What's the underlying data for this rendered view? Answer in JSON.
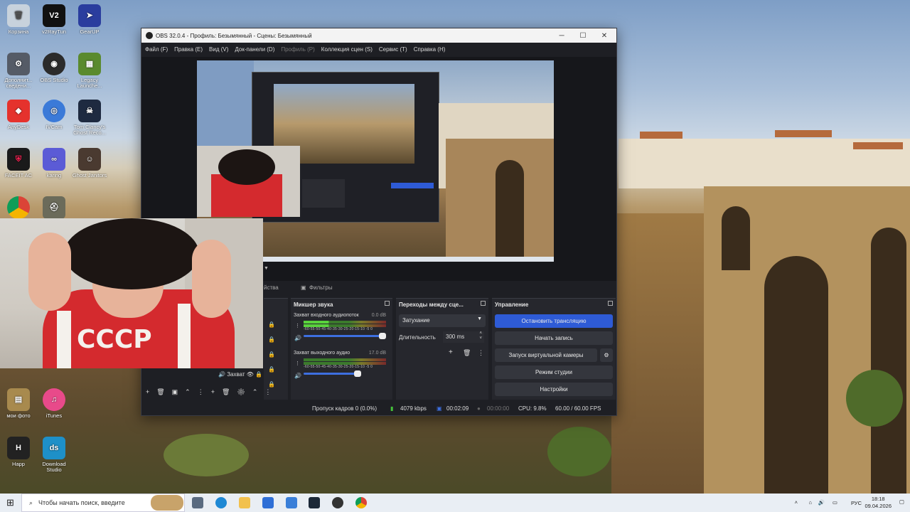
{
  "desktop": {
    "icons": [
      {
        "label": "Корзина",
        "color": "#c8d2dc"
      },
      {
        "label": "v2RayTun",
        "color": "#111111"
      },
      {
        "label": "GearUP",
        "color": "#2a3d9e"
      },
      {
        "label": "Дополнит... сведени...",
        "color": "#555b66"
      },
      {
        "label": "OBS Studio",
        "color": "#2b2b2b"
      },
      {
        "label": "Legacy Launche...",
        "color": "#5a8a2e"
      },
      {
        "label": "AnyDesk",
        "color": "#e5322d"
      },
      {
        "label": "IVCam",
        "color": "#3b7ad8"
      },
      {
        "label": "Tom Clancy's Ghost Reco...",
        "color": "#1e2a40"
      },
      {
        "label": "FACEIT AC",
        "color": "#1a1a1a"
      },
      {
        "label": "karing",
        "color": "#5b5bd6"
      },
      {
        "label": "Ghost Janitors",
        "color": "#4a3a30"
      },
      {
        "label": "мои фото",
        "color": "#a88a4e"
      },
      {
        "label": "iTunes",
        "color": "#e84a8a"
      },
      {
        "label": "Happ",
        "color": "#222222"
      },
      {
        "label": "Download Studio",
        "color": "#1e90c8"
      }
    ]
  },
  "obs": {
    "title": "OBS 32.0.4 - Профиль: Безымянный - Сцены: Безымянный",
    "menu": [
      "Файл (F)",
      "Правка (E)",
      "Вид (V)",
      "Док-панели (D)",
      "Профиль (P)",
      "Коллекция сцен (S)",
      "Сервис (T)",
      "Справка (H)"
    ],
    "tabs": {
      "props": "йства",
      "filters": "Фильтры"
    },
    "mixer": {
      "title": "Микшер звука",
      "channels": [
        {
          "name": "Захват входного аудиопоток",
          "db": "0.0 dB",
          "level": 0.3
        },
        {
          "name": "Захват выходного аудио",
          "db": "17.0 dB",
          "level": 0.0
        }
      ],
      "scale": "-60-55-50-45-40-35-30-25-20-15-10 -5 0"
    },
    "transitions": {
      "title": "Переходы между сце...",
      "selected": "Затухание",
      "duration_label": "Длительность",
      "duration_value": "300 ms"
    },
    "controls": {
      "title": "Управление",
      "stop_stream": "Остановить трансляцию",
      "start_record": "Начать запись",
      "virtual_cam": "Запуск виртуальной камеры",
      "studio_mode": "Режим студии",
      "settings": "Настройки"
    },
    "sources_partial": "Захват",
    "status": {
      "dropped": "Пропуск кадров 0 (0.0%)",
      "bitrate": "4079 kbps",
      "stream_time": "00:02:09",
      "record_time": "00:00:00",
      "cpu": "CPU: 9.8%",
      "fps": "60.00 / 60.00 FPS"
    }
  },
  "taskbar": {
    "search_placeholder": "Чтобы начать поиск, введите",
    "language": "РУС",
    "time": "18:18",
    "date": "09.04.2026"
  },
  "colors": {
    "accent": "#2e5bd6",
    "obs_bg": "#1e1f24",
    "taskbar": "#e9eef4"
  }
}
